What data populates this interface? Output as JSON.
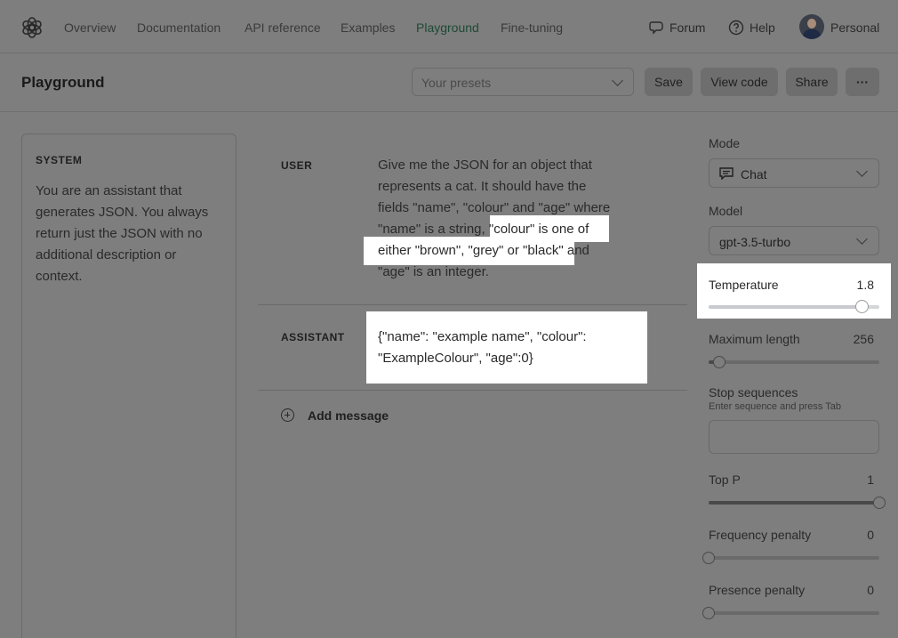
{
  "nav": {
    "links": [
      "Overview",
      "Documentation",
      "API reference",
      "Examples",
      "Playground",
      "Fine-tuning"
    ],
    "active": "Playground",
    "forum": "Forum",
    "help": "Help",
    "account": "Personal",
    "active_color": "#1d4a36"
  },
  "header": {
    "title": "Playground",
    "presets_placeholder": "Your presets",
    "save": "Save",
    "view_code": "View code",
    "share": "Share",
    "more": "···"
  },
  "system": {
    "label": "SYSTEM",
    "text": "You are an assistant that generates JSON.  You always return just the JSON with no additional description or context."
  },
  "messages": [
    {
      "role": "USER",
      "lines": [
        "Give me the JSON for an object that",
        "represents a cat.  It should have the",
        "fields \"name\", \"colour\" and \"age\" where",
        "\"name\" is a string, \"colour\" is one of",
        "either \"brown\", \"grey\" or \"black\" and",
        "\"age\" is an integer."
      ]
    },
    {
      "role": "ASSISTANT",
      "lines": [
        "{\"name\": \"example name\", \"colour\":",
        "\"ExampleColour\", \"age\":0}"
      ]
    }
  ],
  "add_message": "Add message",
  "settings": {
    "mode": {
      "label": "Mode",
      "value": "Chat"
    },
    "model": {
      "label": "Model",
      "value": "gpt-3.5-turbo"
    },
    "temperature": {
      "label": "Temperature",
      "value": "1.8",
      "fraction": 0.9
    },
    "max_length": {
      "label": "Maximum length",
      "value": "256",
      "fraction": 0.06
    },
    "stop_sequences": {
      "label": "Stop sequences",
      "hint": "Enter sequence and press Tab"
    },
    "top_p": {
      "label": "Top P",
      "value": "1",
      "fraction": 1.0
    },
    "frequency_penalty": {
      "label": "Frequency penalty",
      "value": "0",
      "fraction": 0
    },
    "presence_penalty": {
      "label": "Presence penalty",
      "value": "0",
      "fraction": 0
    }
  }
}
